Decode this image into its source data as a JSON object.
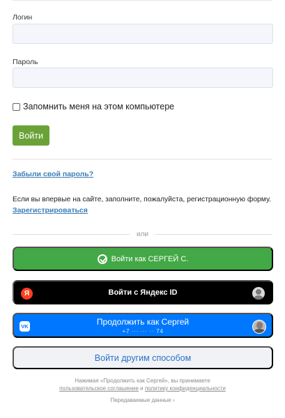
{
  "form": {
    "login_label": "Логин",
    "login_value": "",
    "password_label": "Пароль",
    "password_value": "",
    "remember_label": "Запомнить меня на этом компьютере",
    "remember_checked": false,
    "submit_label": "Войти",
    "forgot_link": "Забыли свой пароль?",
    "register_text": "Если вы впервые на сайте, заполните, пожалуйста, регистрационную форму.",
    "register_link": "Зарегистрироваться"
  },
  "separator": {
    "or_text": "или"
  },
  "sber": {
    "label": "Войти как СЕРГЕЙ С.",
    "color": "#43a846"
  },
  "yandex": {
    "label": "Войти с Яндекс ID",
    "logo_letter": "Я",
    "color": "#000000"
  },
  "vk": {
    "label": "Продолжить как Сергей",
    "phone": "+7 ··· ··· ·· 74",
    "logo_text": "VK",
    "color": "#0077ff"
  },
  "other": {
    "label": "Войти другим способом"
  },
  "legal": {
    "line1": "Нажимая «Продолжить как Сергей», вы принимаете",
    "agreement_link": "пользовательское соглашение",
    "and": " и ",
    "privacy_link": "политику конфиденциальности",
    "transfer_link": "Передаваемые данные ›"
  }
}
